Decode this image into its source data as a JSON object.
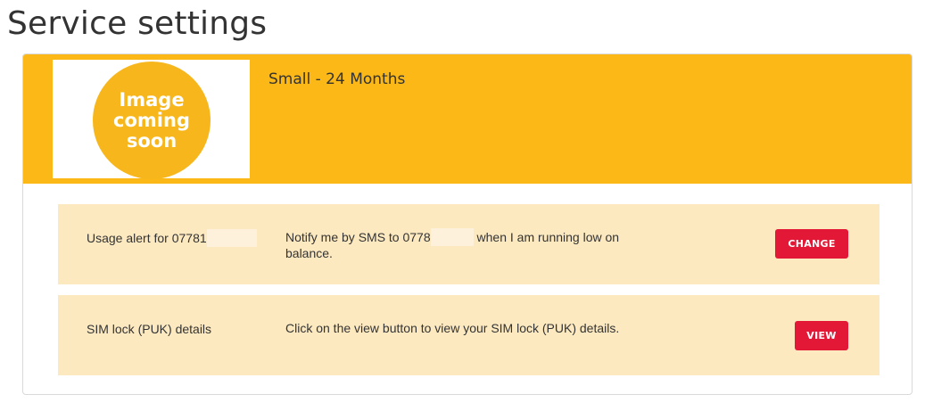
{
  "page": {
    "title": "Service settings"
  },
  "plan": {
    "image_text": "Image\ncoming\nsoon",
    "name": "Small - 24 Months"
  },
  "usage_alert": {
    "label_prefix": "Usage alert for 07781",
    "desc_prefix": "Notify me by SMS to 0778",
    "desc_suffix": "when I am running low on balance.",
    "button_label": "CHANGE"
  },
  "sim_lock": {
    "label": "SIM lock (PUK) details",
    "desc": "Click on the view button to view your SIM lock (PUK) details.",
    "button_label": "VIEW"
  },
  "colors": {
    "header_yellow": "#fbb817",
    "row_background": "#fde9c0",
    "button_red": "#e31837"
  }
}
